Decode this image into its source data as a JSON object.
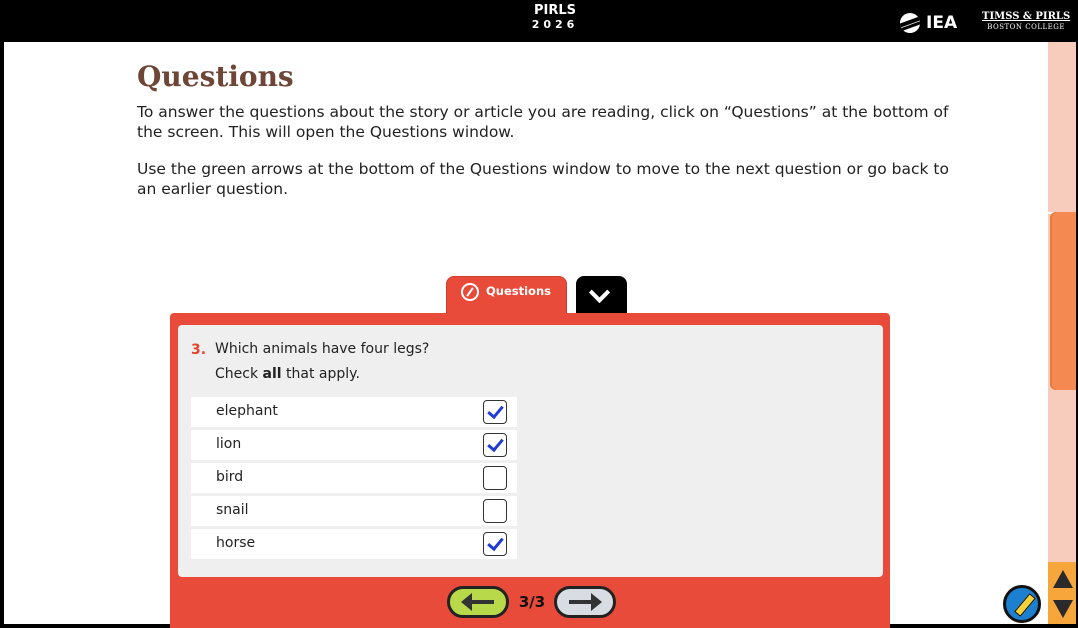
{
  "header": {
    "brand_line1": "PIRLS",
    "brand_line2": "2026",
    "iea_label": "IEA",
    "org_line1": "TIMSS & PIRLS",
    "org_line2": "BOSTON COLLEGE"
  },
  "page": {
    "title": "Questions",
    "paragraph1": "To answer the questions about the story or article you are reading, click on “Questions” at the bottom of the screen. This will open the Questions window.",
    "paragraph2": "Use the green arrows at the bottom of the Questions window to move to the next question or go back to an earlier question."
  },
  "questions_window": {
    "tab_label": "Questions",
    "question_number": "3.",
    "question_text": "Which animals have four legs?",
    "instruction_before": "Check ",
    "instruction_bold": "all",
    "instruction_after": " that apply.",
    "options": [
      {
        "label": "elephant",
        "checked": true
      },
      {
        "label": "lion",
        "checked": true
      },
      {
        "label": "bird",
        "checked": false
      },
      {
        "label": "snail",
        "checked": false
      },
      {
        "label": "horse",
        "checked": true
      }
    ],
    "pager": "3/3"
  },
  "colors": {
    "panel_red": "#e84b3a",
    "title_brown": "#6e4638",
    "scroll_thumb": "#f48a52",
    "back_arrow_green": "#b7d94a",
    "check_blue": "#1f3bd6"
  },
  "icons": [
    "iea-logo-icon",
    "pencil-icon",
    "chevron-down-icon",
    "arrow-left-icon",
    "arrow-right-icon",
    "scroll-up-icon",
    "scroll-down-icon",
    "pen-tool-icon"
  ]
}
